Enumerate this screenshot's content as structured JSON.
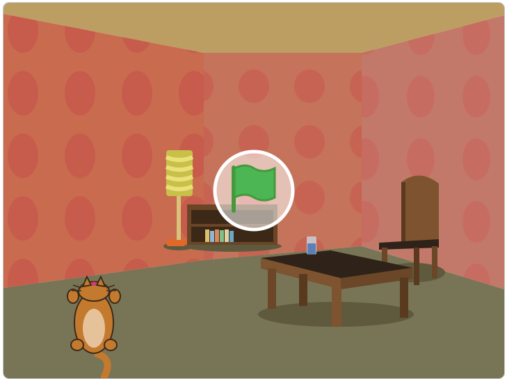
{
  "stage": {
    "scene": "room",
    "colors": {
      "ceiling": "#bd9e62",
      "wall_left": "#c86b4f",
      "wall_back": "#c5735a",
      "wall_right": "#c2796a",
      "wall_dot": "#c5554a",
      "floor": "#787556",
      "wood": "#7d5330",
      "wood_dark": "#5a3a1f",
      "lamp_shade": "#c9c04a"
    }
  },
  "green_flag_overlay": {
    "icon": "green-flag-icon",
    "ring_color": "#ffffff",
    "flag_color": "#4cb654"
  },
  "sprites": [
    {
      "name": "cat",
      "icon": "cat-sprite-icon"
    }
  ]
}
